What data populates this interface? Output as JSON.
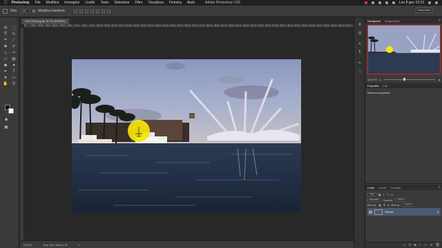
{
  "menubar": {
    "apple_icon": "apple-icon",
    "items": [
      "Photoshop",
      "File",
      "Modifica",
      "Immagine",
      "Livello",
      "Testo",
      "Selezione",
      "Filtro",
      "Visualizza",
      "Finestra",
      "Aiuto"
    ],
    "center_title": "Adobe Photoshop CS6",
    "clock": "Lun 8 gen  10:23"
  },
  "options": {
    "size_label": "Dim.",
    "size_value": "100",
    "auto_label": "Modifica trasform.",
    "workspace_value": "Essenziali"
  },
  "document": {
    "tab_title": "DSC0334.jpg @ 16,7% (RGB/8*)",
    "ruler_labels": [
      "0",
      "100",
      "200",
      "300",
      "400",
      "500",
      "600",
      "700",
      "800",
      "900",
      "1000",
      "1100",
      "1200",
      "1300",
      "1400",
      "1500",
      "1600",
      "1700",
      "1800",
      "1900",
      "2000",
      "2100",
      "2200",
      "2300",
      "2400",
      "2500",
      "2600",
      "2700",
      "2800",
      "2900",
      "3000",
      "3100",
      "3200",
      "3300",
      "3400",
      "3500",
      "3600",
      "3700",
      "3800",
      "3900",
      "4000",
      "4100",
      "4200",
      "4300",
      "4500"
    ]
  },
  "status": {
    "zoom": "16,67%",
    "doc_info": "Doc: 36,1 M/36,1 M"
  },
  "navigator": {
    "tabs": [
      "Navigatore",
      "Istogramma"
    ],
    "zoom": "16,67%"
  },
  "properties": {
    "tabs": [
      "Proprietà",
      "Info"
    ],
    "body": "Nessuna proprietà"
  },
  "layers": {
    "tabs": [
      "Livelli",
      "Canali",
      "Tracciati"
    ],
    "kind_label": "Tipo",
    "mode": "Normale",
    "opacity_label": "Opacità:",
    "opacity": "100%",
    "lock_label": "Blocca:",
    "fill_label": "Riemp.:",
    "fill": "100%",
    "layer_name": "Sfondo"
  },
  "colors": {
    "highlight": "#f5e600",
    "nav_box": "#dd2222"
  }
}
